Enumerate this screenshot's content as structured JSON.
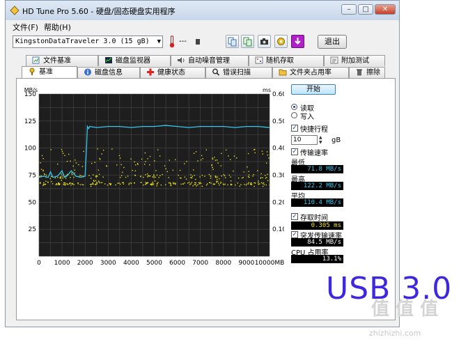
{
  "window": {
    "title": "HD Tune Pro 5.60 - 硬盘/固态硬盘实用程序",
    "minimize": "–",
    "maximize": "□",
    "close": "✕"
  },
  "menu": [
    {
      "label": "文件(F)"
    },
    {
      "label": "帮助(H)"
    }
  ],
  "toolbar": {
    "drive": "KingstonDataTraveler 3.0 (15 gB)",
    "temperature": "---",
    "exit_label": "退出"
  },
  "tabs_top": [
    {
      "label": "文件基准",
      "icon": "file-benchmark-icon"
    },
    {
      "label": "磁盘监视器",
      "icon": "disk-monitor-icon"
    },
    {
      "label": "自动噪音管理",
      "icon": "speaker-icon"
    },
    {
      "label": "随机存取",
      "icon": "random-access-icon"
    },
    {
      "label": "附加测试",
      "icon": "extra-tests-icon"
    }
  ],
  "tabs_bottom": [
    {
      "label": "基准",
      "icon": "benchmark-icon"
    },
    {
      "label": "磁盘信息",
      "icon": "info-icon"
    },
    {
      "label": "健康状态",
      "icon": "health-icon"
    },
    {
      "label": "错误扫描",
      "icon": "search-icon"
    },
    {
      "label": "文件夹占用率",
      "icon": "folder-icon"
    },
    {
      "label": "擦除",
      "icon": "trash-icon"
    }
  ],
  "controls": {
    "start_label": "开始",
    "read_label": "读取",
    "write_label": "写入",
    "mode": "read",
    "short_stroke_label": "快捷行程",
    "short_stroke_checked": true,
    "short_stroke_value": "10",
    "short_stroke_unit": "gB",
    "transfer_rate_label": "传输速率",
    "transfer_rate_checked": true,
    "min_label": "最低",
    "min_value": "71.8 MB/s",
    "max_label": "最高",
    "max_value": "122.2 MB/s",
    "avg_label": "平均",
    "avg_value": "110.4 MB/s",
    "access_time_label": "存取时间",
    "access_time_checked": true,
    "access_time_value": "0.305 ms",
    "burst_label": "突发传输速率",
    "burst_checked": true,
    "burst_value": "84.5 MB/s",
    "cpu_label": "CPU 占用率",
    "cpu_value": "13.1%"
  },
  "chart_data": {
    "type": "line",
    "ylabel": "MB/s",
    "y2label": "ms",
    "xunit": "MB",
    "ylim": [
      0,
      150
    ],
    "y2lim": [
      0,
      0.6
    ],
    "xlim": [
      0,
      10000
    ],
    "yticks": [
      "150",
      "125",
      "100",
      "75",
      "50",
      "25"
    ],
    "y2ticks": [
      "0.60",
      "0.50",
      "0.40",
      "0.30",
      "0.20",
      "0.10"
    ],
    "xticks": [
      "0",
      "1000",
      "2000",
      "3000",
      "4000",
      "5000",
      "6000",
      "7000",
      "8000",
      "9000",
      "10000MB"
    ],
    "grid": true,
    "background": "#1e1e1e",
    "series": [
      {
        "color": "#35c8f0",
        "x": [
          0,
          200,
          400,
          500,
          600,
          800,
          1000,
          1100,
          1200,
          1400,
          1600,
          1800,
          2000,
          2050,
          2100,
          2150,
          2200,
          2500,
          3000,
          3500,
          4000,
          4500,
          5000,
          5500,
          6000,
          6500,
          7000,
          7500,
          8000,
          8500,
          9000,
          9500,
          10000
        ],
        "y": [
          73,
          74,
          73,
          78,
          73,
          74,
          79,
          73,
          74,
          79,
          74,
          73,
          74,
          95,
          120,
          118,
          120,
          119,
          120,
          120,
          119,
          120,
          120,
          121,
          120,
          119,
          120,
          120,
          120,
          119,
          120,
          120,
          119
        ]
      }
    ],
    "scatter_color": "#e8e020",
    "scatter_band_ms": [
      0.26,
      0.4
    ]
  },
  "overlay": {
    "usb_label": "USB 3.0",
    "watermark": "值 值 值",
    "watermark_url": "zhizhizhi.com"
  },
  "colors": {
    "cyan_series": "#35c8f0",
    "yellow_points": "#e8e020",
    "usb_label": "#3d28e0"
  }
}
